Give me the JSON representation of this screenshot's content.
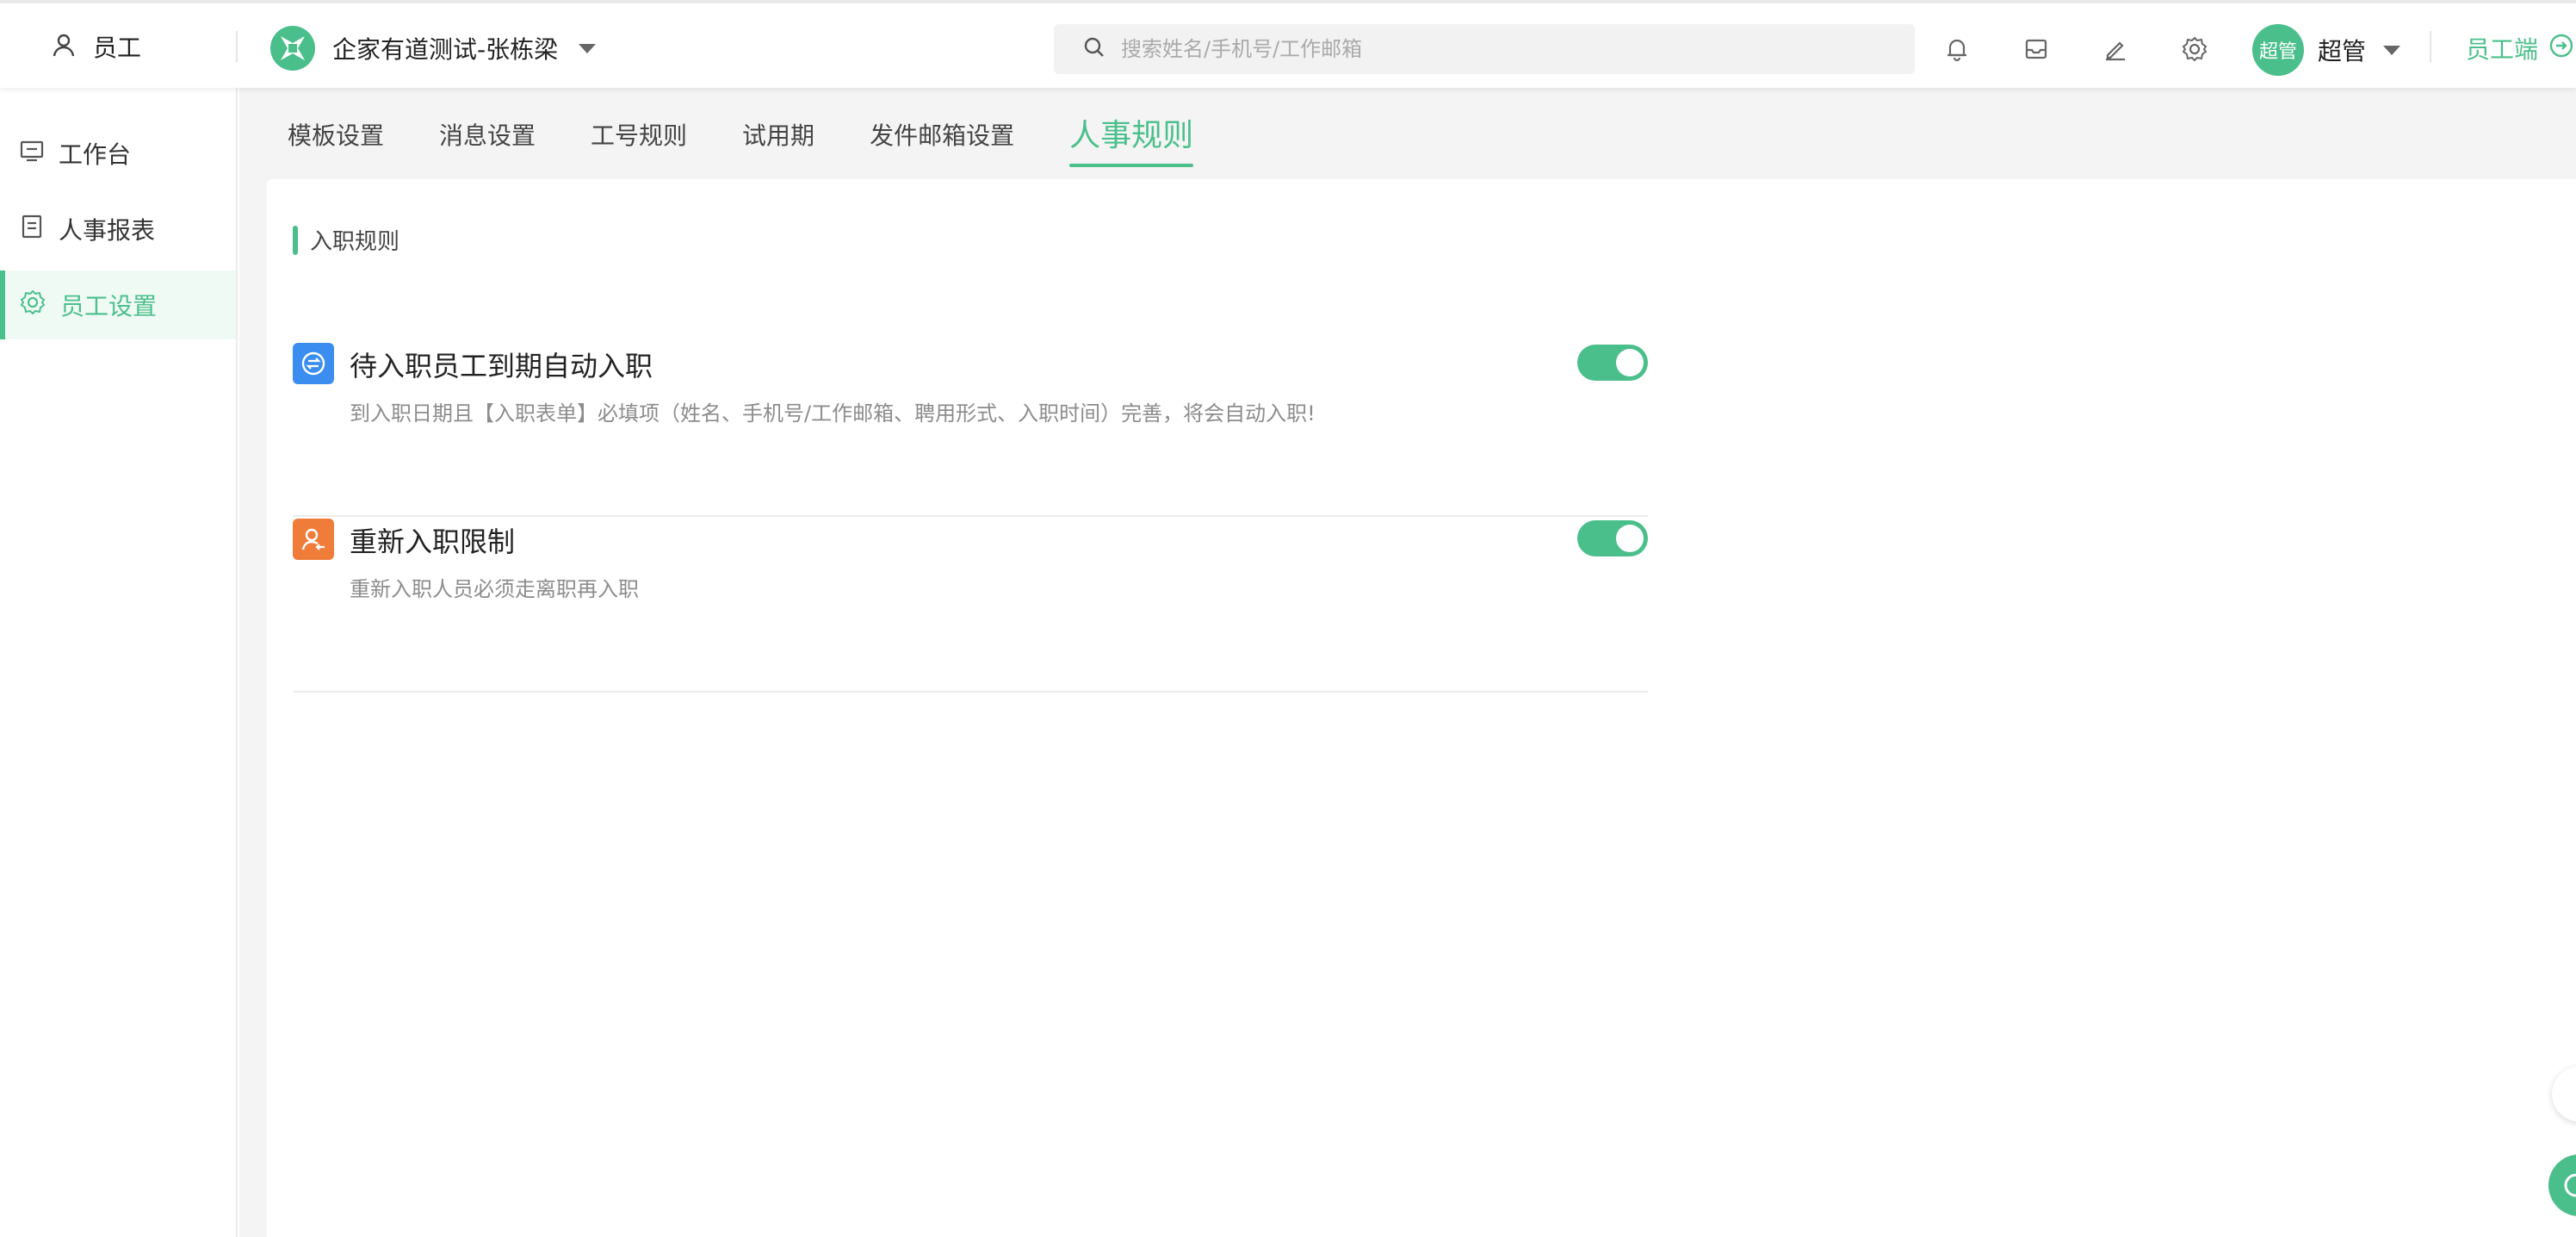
{
  "topbar": {
    "app_label": "员工",
    "company_name": "企家有道测试-张栋梁",
    "search_placeholder": "搜索姓名/手机号/工作邮箱",
    "user_avatar_text": "超管",
    "user_name": "超管",
    "employee_portal": "员工端"
  },
  "sidebar": {
    "items": [
      {
        "label": "工作台"
      },
      {
        "label": "人事报表"
      },
      {
        "label": "员工设置"
      }
    ]
  },
  "tabs": [
    {
      "label": "模板设置"
    },
    {
      "label": "消息设置"
    },
    {
      "label": "工号规则"
    },
    {
      "label": "试用期"
    },
    {
      "label": "发件邮箱设置"
    },
    {
      "label": "人事规则"
    }
  ],
  "section": {
    "title": "入职规则"
  },
  "rules": [
    {
      "title": "待入职员工到期自动入职",
      "desc": "到入职日期且【入职表单】必填项（姓名、手机号/工作邮箱、聘用形式、入职时间）完善，将会自动入职!",
      "enabled": true,
      "icon": "auto-entry-icon"
    },
    {
      "title": "重新入职限制",
      "desc": "重新入职人员必须走离职再入职",
      "enabled": true,
      "icon": "re-entry-user-icon"
    }
  ],
  "colors": {
    "accent": "#4bbf8b",
    "blue_icon": "#3b8ef0",
    "orange_icon": "#f07c3a"
  }
}
